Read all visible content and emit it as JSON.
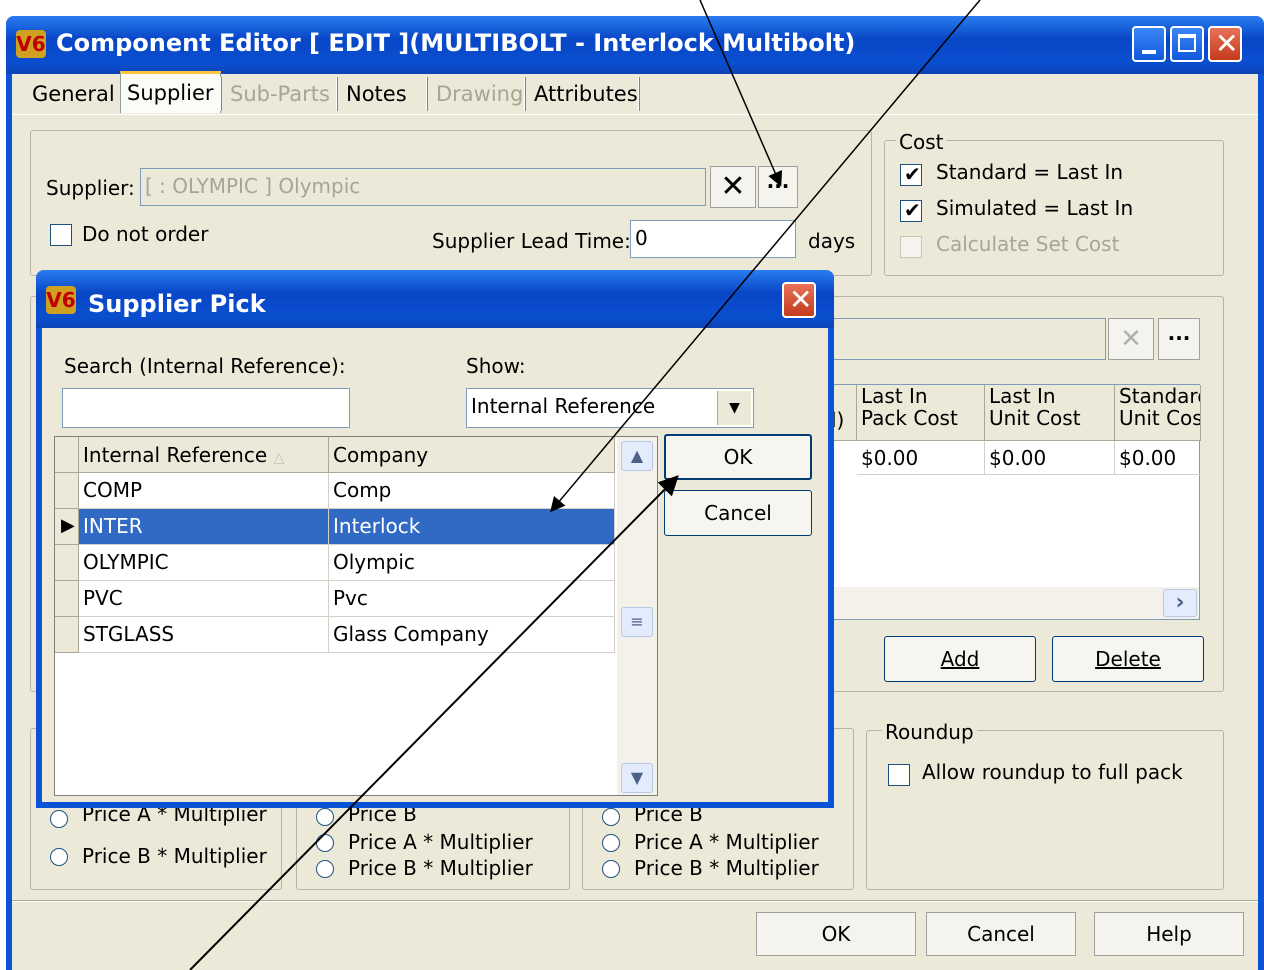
{
  "window": {
    "title": "Component Editor  [ EDIT ](MULTIBOLT - Interlock Multibolt)",
    "icon_text": "V6"
  },
  "tabs": [
    {
      "label": "General",
      "active": false,
      "enabled": true
    },
    {
      "label": "Supplier",
      "active": true,
      "enabled": true
    },
    {
      "label": "Sub-Parts",
      "active": false,
      "enabled": false
    },
    {
      "label": "Notes",
      "active": false,
      "enabled": true
    },
    {
      "label": "Drawing",
      "active": false,
      "enabled": false
    },
    {
      "label": "Attributes",
      "active": false,
      "enabled": true
    }
  ],
  "supplier": {
    "label": "Supplier:",
    "value": "[ : OLYMPIC ]  Olympic",
    "clear_glyph": "✕",
    "browse_glyph": "···",
    "do_not_order_label": "Do not order",
    "do_not_order_checked": false,
    "lead_time_label": "Supplier Lead Time:",
    "lead_time_value": "0",
    "lead_time_unit": "days"
  },
  "cost": {
    "legend": "Cost",
    "items": [
      {
        "label": "Standard = Last In",
        "checked": true,
        "enabled": true
      },
      {
        "label": "Simulated = Last In",
        "checked": true,
        "enabled": true
      },
      {
        "label": "Calculate Set Cost",
        "checked": false,
        "enabled": false
      }
    ]
  },
  "pricing_table": {
    "headers": [
      "Last In\nPack Cost",
      "Last In\nUnit Cost",
      "Standard\nUnit Cos"
    ],
    "row": [
      "$0.00",
      "$0.00",
      "$0.00"
    ],
    "partial_header": "l)",
    "scroll_right_glyph": "›"
  },
  "table_buttons": {
    "add": "Add",
    "delete": "Delete"
  },
  "roundup": {
    "legend": "Roundup",
    "label": "Allow roundup to full pack",
    "checked": false
  },
  "price_groups": [
    {
      "options": [
        "Price A * Multiplier",
        "Price B * Multiplier"
      ]
    },
    {
      "options": [
        "Price B",
        "Price A * Multiplier",
        "Price B * Multiplier"
      ]
    },
    {
      "options": [
        "Price B",
        "Price A * Multiplier",
        "Price B * Multiplier"
      ]
    }
  ],
  "bottom_buttons": {
    "ok": "OK",
    "cancel": "Cancel",
    "help": "Help"
  },
  "dialog": {
    "title": "Supplier Pick",
    "search_label": "Search (Internal Reference):",
    "search_value": "",
    "show_label": "Show:",
    "show_value": "Internal Reference",
    "columns": [
      "Internal Reference",
      "Company"
    ],
    "rows": [
      {
        "ref": "COMP",
        "company": "Comp",
        "selected": false
      },
      {
        "ref": "INTER",
        "company": "Interlock",
        "selected": true
      },
      {
        "ref": "OLYMPIC",
        "company": "Olympic",
        "selected": false
      },
      {
        "ref": "PVC",
        "company": "Pvc",
        "selected": false
      },
      {
        "ref": "STGLASS",
        "company": "Glass Company",
        "selected": false
      }
    ],
    "ok_label": "OK",
    "cancel_label": "Cancel"
  }
}
